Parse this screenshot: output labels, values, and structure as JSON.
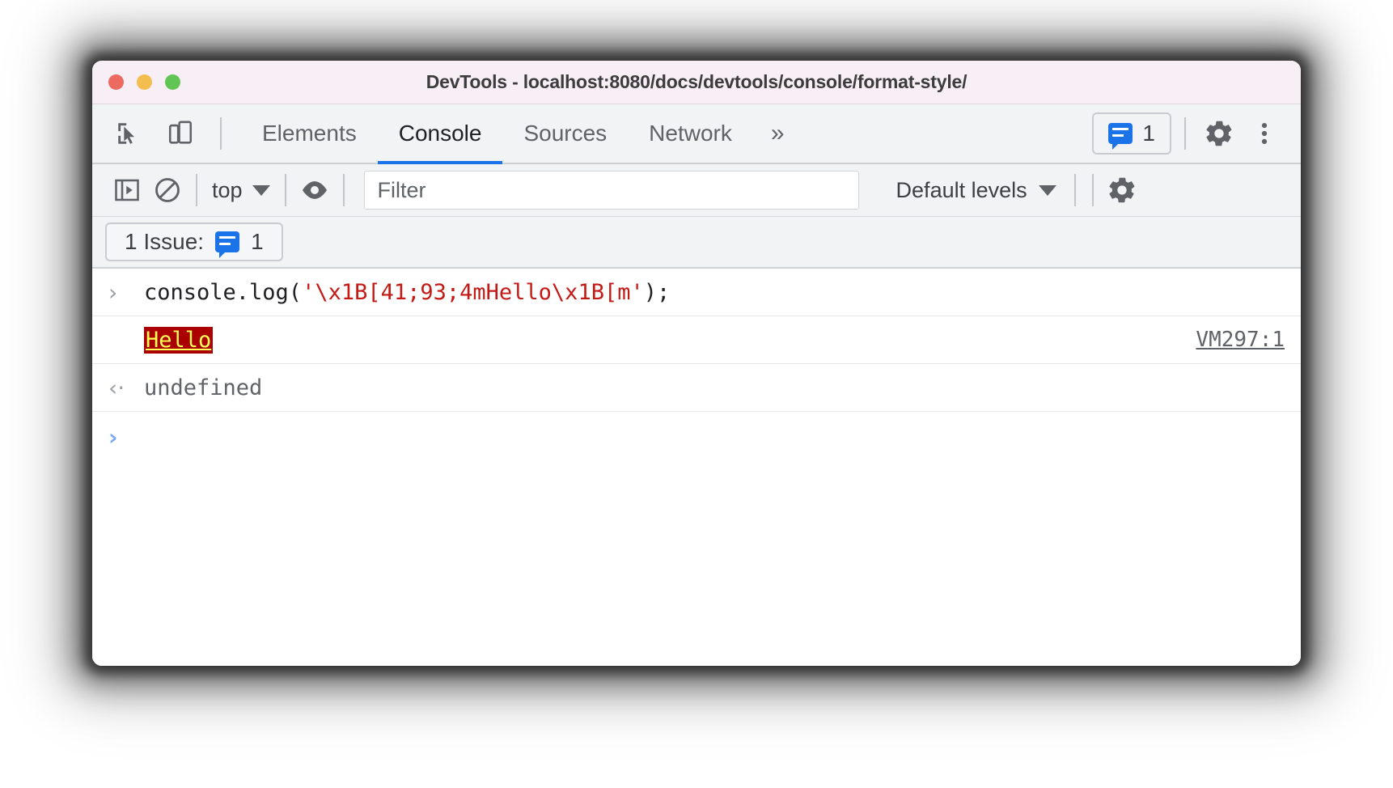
{
  "window": {
    "title": "DevTools - localhost:8080/docs/devtools/console/format-style/",
    "traffic_lights": [
      "close",
      "minimize",
      "maximize"
    ]
  },
  "tabbar": {
    "inspect_icon": "inspect-cursor-icon",
    "device_icon": "device-toolbar-icon",
    "tabs": [
      {
        "label": "Elements",
        "active": false
      },
      {
        "label": "Console",
        "active": true
      },
      {
        "label": "Sources",
        "active": false
      },
      {
        "label": "Network",
        "active": false
      }
    ],
    "more_tabs_label": "»",
    "issues_badge_count": "1",
    "settings_icon": "gear-icon",
    "menu_icon": "three-dot-menu-icon"
  },
  "console_toolbar": {
    "sidebar_icon": "console-sidebar-icon",
    "clear_icon": "clear-console-icon",
    "context": "top",
    "eye_icon": "live-expression-eye-icon",
    "filter_placeholder": "Filter",
    "filter_value": "",
    "levels": "Default levels",
    "settings_icon": "gear-icon"
  },
  "issue_bar": {
    "label": "1 Issue:",
    "count": "1",
    "badge_icon": "issue-bubble-icon"
  },
  "console": {
    "rows": [
      {
        "type": "input",
        "marker": "›",
        "code_prefix": "console.log(",
        "code_string": "'\\x1B[41;93;4mHello\\x1B[m'",
        "code_suffix": ");"
      },
      {
        "type": "output",
        "text": "Hello",
        "style": {
          "background": "#aa0000",
          "color": "#ffff55",
          "underline": true
        },
        "source": "VM297:1"
      },
      {
        "type": "result",
        "marker": "‹·",
        "text": "undefined"
      },
      {
        "type": "prompt",
        "marker": "›"
      }
    ]
  },
  "colors": {
    "accent": "#1a73e8",
    "titlebar_bg": "#f7eff5",
    "toolbar_bg": "#f1f3f4",
    "ansi_bg": "#aa0000",
    "ansi_fg": "#ffff55",
    "string_red": "#c41a16"
  }
}
